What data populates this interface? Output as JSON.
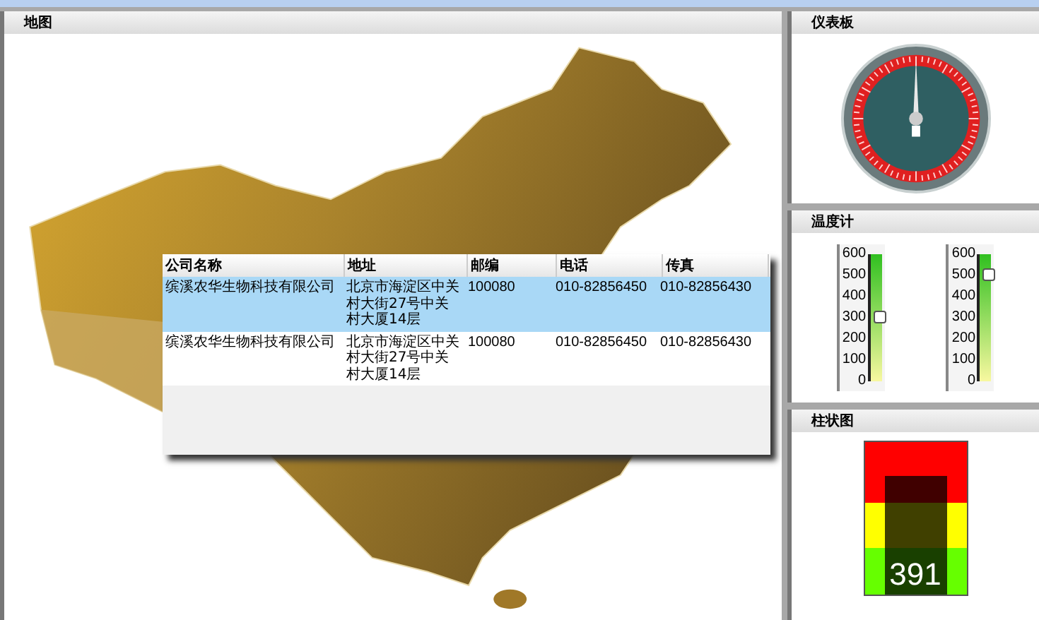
{
  "map_panel": {
    "title": "地图",
    "table": {
      "columns": [
        "公司名称",
        "地址",
        "邮编",
        "电话",
        "传真"
      ],
      "rows": [
        {
          "selected": true,
          "cells": [
            "缤溪农华生物科技有限公司",
            "北京市海淀区中关村大街27号中关村大厦14层",
            "100080",
            "010-82856450",
            "010-82856430"
          ]
        },
        {
          "selected": false,
          "cells": [
            "缤溪农华生物科技有限公司",
            "北京市海淀区中关村大街27号中关村大厦14层",
            "100080",
            "010-82856450",
            "010-82856430"
          ]
        }
      ]
    }
  },
  "gauge_panel": {
    "title": "仪表板",
    "gauge": {
      "level": 0.5
    }
  },
  "thermometer_panel": {
    "title": "温度计",
    "thermometers": [
      {
        "level": 0.5,
        "scale": [
          "600",
          "500",
          "400",
          "300",
          "200",
          "100",
          "0"
        ]
      },
      {
        "level": 0.833,
        "scale": [
          "600",
          "500",
          "400",
          "300",
          "200",
          "100",
          "0"
        ]
      }
    ]
  },
  "bar_panel": {
    "title": "柱状图",
    "meter": {
      "level": 0.78,
      "reading": "391"
    }
  }
}
